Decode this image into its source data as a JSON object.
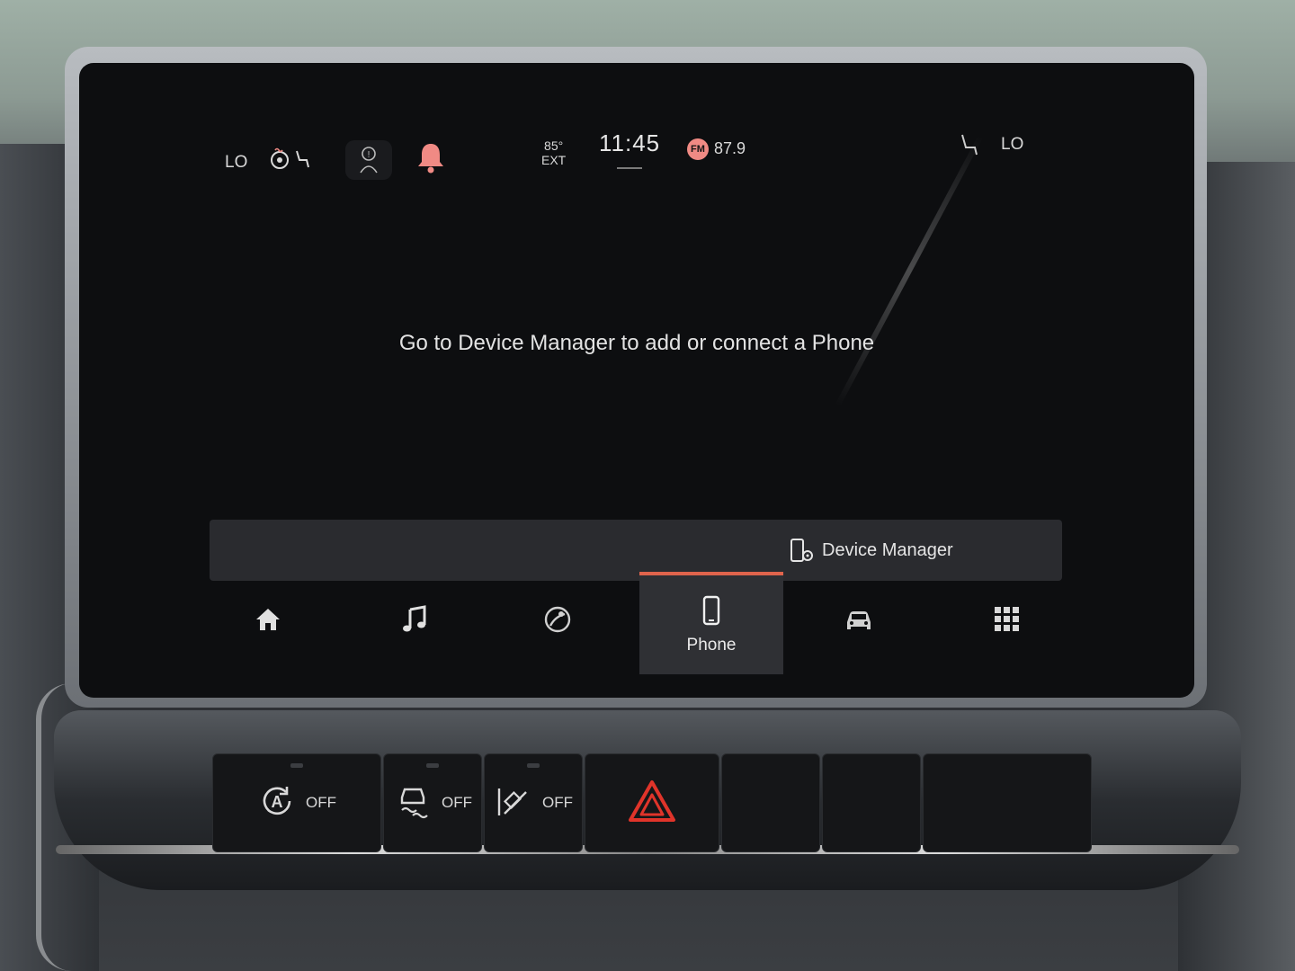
{
  "status_bar": {
    "left_temp": "LO",
    "right_temp": "LO",
    "exterior_temp": "85°",
    "exterior_label": "EXT",
    "clock": "11:45",
    "radio_band": "FM",
    "radio_frequency": "87.9",
    "icons": [
      "heated-steering-seat-icon",
      "driver-alert-icon",
      "notification-bell-icon",
      "passenger-seat-icon"
    ],
    "bell_color": "#f08a84"
  },
  "main": {
    "message": "Go to Device Manager to add or connect a Phone",
    "device_manager_label": "Device Manager"
  },
  "nav": {
    "items": [
      {
        "icon": "home-icon"
      },
      {
        "icon": "music-note-icon"
      },
      {
        "icon": "navigation-icon"
      },
      {
        "icon": "phone-icon",
        "label": "Phone",
        "active": true
      },
      {
        "icon": "vehicle-icon"
      },
      {
        "icon": "apps-grid-icon"
      }
    ],
    "active_accent": "#e0644c"
  },
  "hardkeys": {
    "auto_stop_label": "OFF",
    "traction_label": "OFF",
    "hill_descent_label": "OFF",
    "hazard_color": "#e0342a"
  }
}
